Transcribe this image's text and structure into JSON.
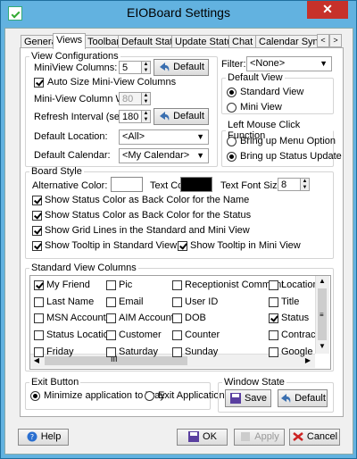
{
  "window": {
    "title": "EIOBoard Settings",
    "close_glyph": "✕"
  },
  "tabs": [
    "General",
    "Views",
    "Toolbar",
    "Default Status",
    "Update Status",
    "Chat",
    "Calendar Sync"
  ],
  "tab_scroll": {
    "left": "<",
    "right": ">"
  },
  "view_config": {
    "legend": "View Configurations",
    "miniview_columns_label": "MiniView Columns:",
    "miniview_columns_value": "5",
    "default_button": "Default",
    "auto_size_label": "Auto Size Mini-View Columns",
    "auto_size_checked": true,
    "col_width_label": "Mini-View Column Width:",
    "col_width_value": "80",
    "refresh_label": "Refresh Interval (sec):",
    "refresh_value": "180",
    "default_location_label": "Default Location:",
    "default_location_value": "<All>",
    "default_calendar_label": "Default Calendar:",
    "default_calendar_value": "<My Calendar>"
  },
  "filter": {
    "label": "Filter:",
    "value": "<None>"
  },
  "default_view": {
    "legend": "Default View",
    "options": [
      {
        "label": "Standard View",
        "selected": true
      },
      {
        "label": "Mini View",
        "selected": false
      }
    ]
  },
  "left_click": {
    "legend": "Left Mouse Click Function",
    "options": [
      {
        "label": "Bring up Menu Option",
        "selected": false
      },
      {
        "label": "Bring up Status Update",
        "selected": true
      }
    ]
  },
  "board_style": {
    "legend": "Board Style",
    "alt_color_label": "Alternative Color:",
    "alt_color": "#ffffff",
    "text_color_label": "Text Color:",
    "text_color": "#000000",
    "font_size_label": "Text Font Size:",
    "font_size_value": "8",
    "checks": [
      {
        "label": "Show Status Color as Back Color for the Name",
        "checked": true
      },
      {
        "label": "Show Status Color as Back Color for the Status",
        "checked": true
      },
      {
        "label": "Show Grid Lines in the Standard and Mini View",
        "checked": true
      },
      {
        "label": "Show Tooltip in Standard View",
        "checked": true
      },
      {
        "label": "Show Tooltip in Mini View",
        "checked": true
      }
    ]
  },
  "columns": {
    "legend": "Standard View Columns",
    "rows": [
      [
        {
          "label": "My Friend",
          "checked": true
        },
        {
          "label": "Pic",
          "checked": false
        },
        {
          "label": "Receptionist Comment",
          "checked": false
        },
        {
          "label": "Location",
          "checked": false
        }
      ],
      [
        {
          "label": "Last Name",
          "checked": false
        },
        {
          "label": "Email",
          "checked": false
        },
        {
          "label": "User ID",
          "checked": false
        },
        {
          "label": "Title",
          "checked": false
        }
      ],
      [
        {
          "label": "MSN Account",
          "checked": false
        },
        {
          "label": "AIM Account",
          "checked": false
        },
        {
          "label": "DOB",
          "checked": false
        },
        {
          "label": "Status",
          "checked": true
        }
      ],
      [
        {
          "label": "Status Location",
          "checked": false
        },
        {
          "label": "Customer",
          "checked": false
        },
        {
          "label": "Counter",
          "checked": false
        },
        {
          "label": "Contractor",
          "checked": false
        }
      ],
      [
        {
          "label": "Friday",
          "checked": false
        },
        {
          "label": "Saturday",
          "checked": false
        },
        {
          "label": "Sunday",
          "checked": false
        },
        {
          "label": "Google Voi",
          "checked": false
        }
      ]
    ]
  },
  "exit_button": {
    "legend": "Exit Button",
    "options": [
      {
        "label": "Minimize application to Tray",
        "selected": true
      },
      {
        "label": "Exit Application",
        "selected": false
      }
    ]
  },
  "window_state": {
    "legend": "Window State",
    "save": "Save",
    "default": "Default"
  },
  "footer": {
    "help": "Help",
    "ok": "OK",
    "apply": "Apply",
    "cancel": "Cancel"
  },
  "colors": {
    "accent": "#62b2e0",
    "close": "#c7312a"
  }
}
